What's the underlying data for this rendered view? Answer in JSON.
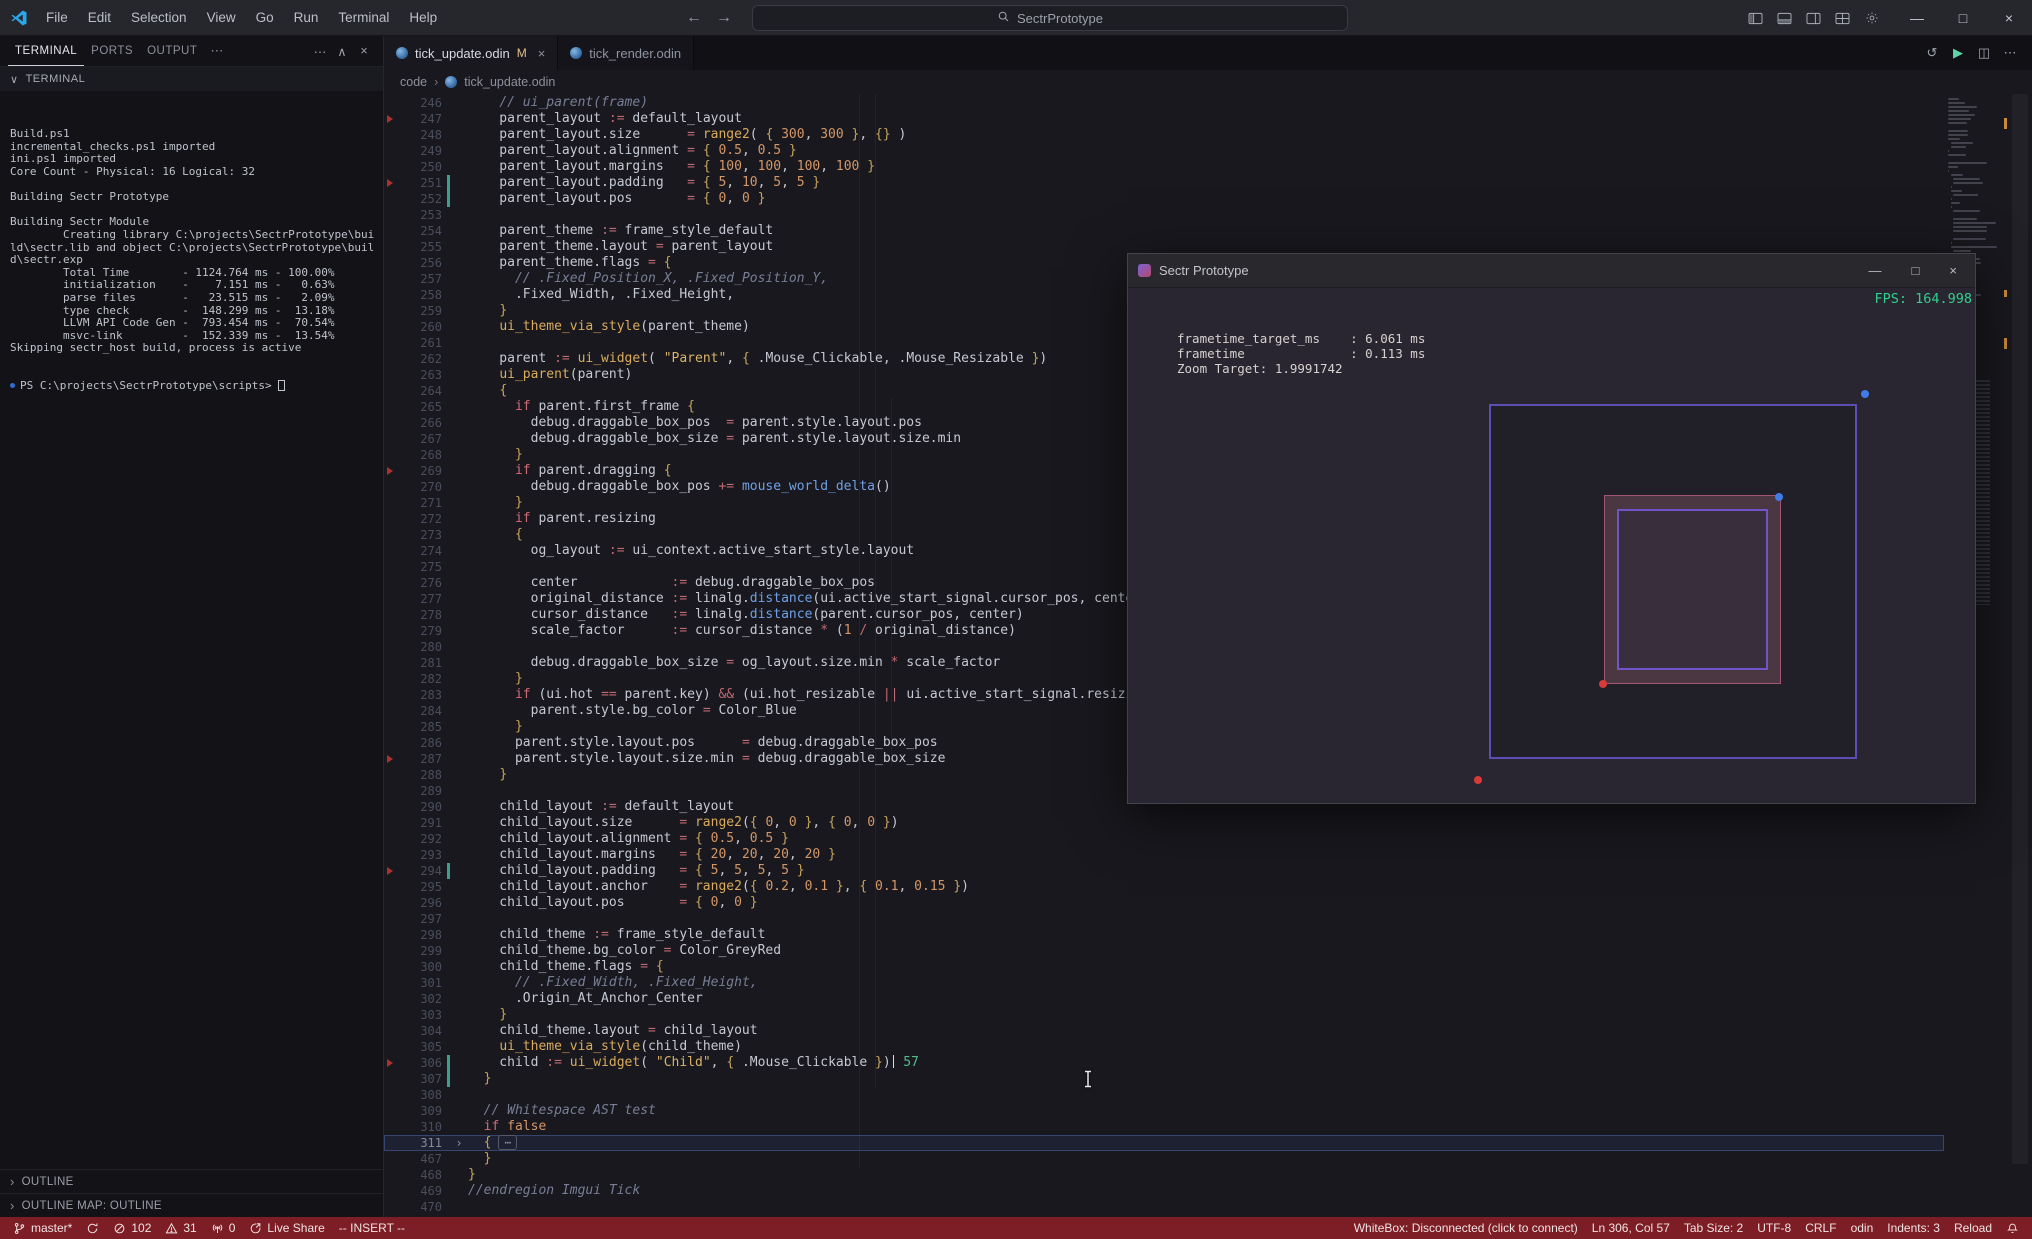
{
  "colors": {
    "editor_bg": "#18181e",
    "panel_bg": "#121217",
    "tabstrip_bg": "#101015",
    "titlebar_bg": "#26262d",
    "statusbar_bg": "#7d1d25",
    "app_bg": "#2a2631",
    "fps_green": "#2fd08a",
    "accent_blue": "#3f7ce8",
    "dot_red": "#d83a3a",
    "git_modified": "#3f9e8a",
    "marker_red": "#a83232"
  },
  "icons": {
    "back": "←",
    "forward": "→",
    "more": "⋯",
    "chevron_up": "∧",
    "chevron_down": "∨",
    "chevron_right": "›",
    "close": "×",
    "minimize": "—",
    "maximize": "□",
    "compare": "↺",
    "run": "▶",
    "split": "◫",
    "fold_ellipsis": "⋯",
    "modified_badge": "M"
  },
  "titlebar": {
    "menus": [
      "File",
      "Edit",
      "Selection",
      "View",
      "Go",
      "Run",
      "Terminal",
      "Help"
    ],
    "search_label": "SectrPrototype"
  },
  "panel": {
    "tabs": [
      {
        "label": "TERMINAL",
        "active": true
      },
      {
        "label": "PORTS",
        "active": false
      },
      {
        "label": "OUTPUT",
        "active": false
      }
    ],
    "section_label": "TERMINAL",
    "terminal_lines": [
      "Build.ps1",
      "incremental_checks.ps1 imported",
      "ini.ps1 imported",
      "Core Count - Physical: 16 Logical: 32",
      "",
      "Building Sectr Prototype",
      "",
      "Building Sectr Module",
      "        Creating library C:\\projects\\SectrPrototype\\build\\sectr.lib and object C:\\projects\\SectrPrototype\\build\\sectr.exp",
      "        Total Time        - 1124.764 ms - 100.00%",
      "        initialization    -    7.151 ms -   0.63%",
      "        parse files       -   23.515 ms -   2.09%",
      "        type check        -  148.299 ms -  13.18%",
      "        LLVM API Code Gen -  793.454 ms -  70.54%",
      "        msvc-link         -  152.339 ms -  13.54%",
      "Skipping sectr_host build, process is active"
    ],
    "prompt": "PS C:\\projects\\SectrPrototype\\scripts> ",
    "outline_label": "OUTLINE",
    "outline_map_label": "OUTLINE MAP: OUTLINE"
  },
  "editor": {
    "tabs": [
      {
        "name": "tick_update.odin",
        "modified": true,
        "active": true,
        "closable": true
      },
      {
        "name": "tick_render.odin",
        "modified": false,
        "active": false,
        "closable": false
      }
    ],
    "breadcrumb": [
      "code",
      "tick_update.odin"
    ],
    "cursor": {
      "line": 306,
      "col": 57
    },
    "lines": [
      {
        "n": 246,
        "t": "    // ui_parent(frame)"
      },
      {
        "n": 247,
        "t": "    parent_layout := default_layout",
        "m": 1
      },
      {
        "n": 248,
        "t": "    parent_layout.size      = range2( { 300, 300 }, {} )"
      },
      {
        "n": 249,
        "t": "    parent_layout.alignment = { 0.5, 0.5 }"
      },
      {
        "n": 250,
        "t": "    parent_layout.margins   = { 100, 100, 100, 100 }"
      },
      {
        "n": 251,
        "t": "    parent_layout.padding   = { 5, 10, 5, 5 }",
        "m": 1,
        "g": 1
      },
      {
        "n": 252,
        "t": "    parent_layout.pos       = { 0, 0 }",
        "g": 1
      },
      {
        "n": 253,
        "t": ""
      },
      {
        "n": 254,
        "t": "    parent_theme := frame_style_default"
      },
      {
        "n": 255,
        "t": "    parent_theme.layout = parent_layout"
      },
      {
        "n": 256,
        "t": "    parent_theme.flags = {"
      },
      {
        "n": 257,
        "t": "      // .Fixed_Position_X, .Fixed_Position_Y,"
      },
      {
        "n": 258,
        "t": "      .Fixed_Width, .Fixed_Height,"
      },
      {
        "n": 259,
        "t": "    }"
      },
      {
        "n": 260,
        "t": "    ui_theme_via_style(parent_theme)"
      },
      {
        "n": 261,
        "t": ""
      },
      {
        "n": 262,
        "t": "    parent := ui_widget( \"Parent\", { .Mouse_Clickable, .Mouse_Resizable })"
      },
      {
        "n": 263,
        "t": "    ui_parent(parent)"
      },
      {
        "n": 264,
        "t": "    {"
      },
      {
        "n": 265,
        "t": "      if parent.first_frame {"
      },
      {
        "n": 266,
        "t": "        debug.draggable_box_pos  = parent.style.layout.pos"
      },
      {
        "n": 267,
        "t": "        debug.draggable_box_size = parent.style.layout.size.min"
      },
      {
        "n": 268,
        "t": "      }"
      },
      {
        "n": 269,
        "t": "      if parent.dragging {",
        "m": 1
      },
      {
        "n": 270,
        "t": "        debug.draggable_box_pos += mouse_world_delta()"
      },
      {
        "n": 271,
        "t": "      }"
      },
      {
        "n": 272,
        "t": "      if parent.resizing"
      },
      {
        "n": 273,
        "t": "      {"
      },
      {
        "n": 274,
        "t": "        og_layout := ui_context.active_start_style.layout"
      },
      {
        "n": 275,
        "t": ""
      },
      {
        "n": 276,
        "t": "        center            := debug.draggable_box_pos"
      },
      {
        "n": 277,
        "t": "        original_distance := linalg.distance(ui.active_start_signal.cursor_pos, center)"
      },
      {
        "n": 278,
        "t": "        cursor_distance   := linalg.distance(parent.cursor_pos, center)"
      },
      {
        "n": 279,
        "t": "        scale_factor      := cursor_distance * (1 / original_distance)"
      },
      {
        "n": 280,
        "t": ""
      },
      {
        "n": 281,
        "t": "        debug.draggable_box_size = og_layout.size.min * scale_factor"
      },
      {
        "n": 282,
        "t": "      }"
      },
      {
        "n": 283,
        "t": "      if (ui.hot == parent.key) && (ui.hot_resizable || ui.active_start_signal.resizing) {"
      },
      {
        "n": 284,
        "t": "        parent.style.bg_color = Color_Blue"
      },
      {
        "n": 285,
        "t": "      }"
      },
      {
        "n": 286,
        "t": "      parent.style.layout.pos      = debug.draggable_box_pos"
      },
      {
        "n": 287,
        "t": "      parent.style.layout.size.min = debug.draggable_box_size",
        "m": 1
      },
      {
        "n": 288,
        "t": "    }"
      },
      {
        "n": 289,
        "t": ""
      },
      {
        "n": 290,
        "t": "    child_layout := default_layout"
      },
      {
        "n": 291,
        "t": "    child_layout.size      = range2({ 0, 0 }, { 0, 0 })"
      },
      {
        "n": 292,
        "t": "    child_layout.alignment = { 0.5, 0.5 }"
      },
      {
        "n": 293,
        "t": "    child_layout.margins   = { 20, 20, 20, 20 }"
      },
      {
        "n": 294,
        "t": "    child_layout.padding   = { 5, 5, 5, 5 }",
        "m": 1,
        "g": 1
      },
      {
        "n": 295,
        "t": "    child_layout.anchor    = range2({ 0.2, 0.1 }, { 0.1, 0.15 })"
      },
      {
        "n": 296,
        "t": "    child_layout.pos       = { 0, 0 }"
      },
      {
        "n": 297,
        "t": ""
      },
      {
        "n": 298,
        "t": "    child_theme := frame_style_default"
      },
      {
        "n": 299,
        "t": "    child_theme.bg_color = Color_GreyRed"
      },
      {
        "n": 300,
        "t": "    child_theme.flags = {"
      },
      {
        "n": 301,
        "t": "      // .Fixed_Width, .Fixed_Height,"
      },
      {
        "n": 302,
        "t": "      .Origin_At_Anchor_Center"
      },
      {
        "n": 303,
        "t": "    }"
      },
      {
        "n": 304,
        "t": "    child_theme.layout = child_layout"
      },
      {
        "n": 305,
        "t": "    ui_theme_via_style(child_theme)"
      },
      {
        "n": 306,
        "t": "    child := ui_widget( \"Child\", { .Mouse_Clickable })",
        "m": 1,
        "g": 1,
        "i": "57"
      },
      {
        "n": 307,
        "t": "  }",
        "g": 1
      },
      {
        "n": 308,
        "t": ""
      },
      {
        "n": 309,
        "t": "  // Whitespace AST test"
      },
      {
        "n": 310,
        "t": "  if false"
      },
      {
        "n": 311,
        "t": "  {",
        "f": 1,
        "h": 1
      },
      {
        "n": 467,
        "t": "  }"
      },
      {
        "n": 468,
        "t": "}"
      },
      {
        "n": 469,
        "t": "//endregion Imgui Tick"
      },
      {
        "n": 470,
        "t": ""
      }
    ]
  },
  "app_window": {
    "title": "Sectr Prototype",
    "fps": "FPS: 164.998",
    "stats": [
      "frametime_target_ms    : 6.061 ms",
      "frametime              : 0.113 ms",
      "Zoom Target: 1.9991742"
    ]
  },
  "statusbar": {
    "left": [
      {
        "icon": "branch",
        "label": "master*"
      },
      {
        "icon": "sync",
        "label": ""
      },
      {
        "icon": "error",
        "label": "102"
      },
      {
        "icon": "warning",
        "label": "31"
      },
      {
        "icon": "broadcast",
        "label": "0"
      },
      {
        "icon": "liveshare",
        "label": "Live Share"
      },
      {
        "icon": "",
        "label": "-- INSERT --"
      }
    ],
    "right": [
      {
        "icon": "",
        "label": "WhiteBox: Disconnected (click to connect)"
      },
      {
        "icon": "",
        "label": "Ln 306, Col 57"
      },
      {
        "icon": "",
        "label": "Tab Size: 2"
      },
      {
        "icon": "",
        "label": "UTF-8"
      },
      {
        "icon": "",
        "label": "CRLF"
      },
      {
        "icon": "",
        "label": "odin"
      },
      {
        "icon": "",
        "label": "Indents: 3"
      },
      {
        "icon": "",
        "label": "Reload"
      },
      {
        "icon": "bell",
        "label": ""
      }
    ]
  }
}
